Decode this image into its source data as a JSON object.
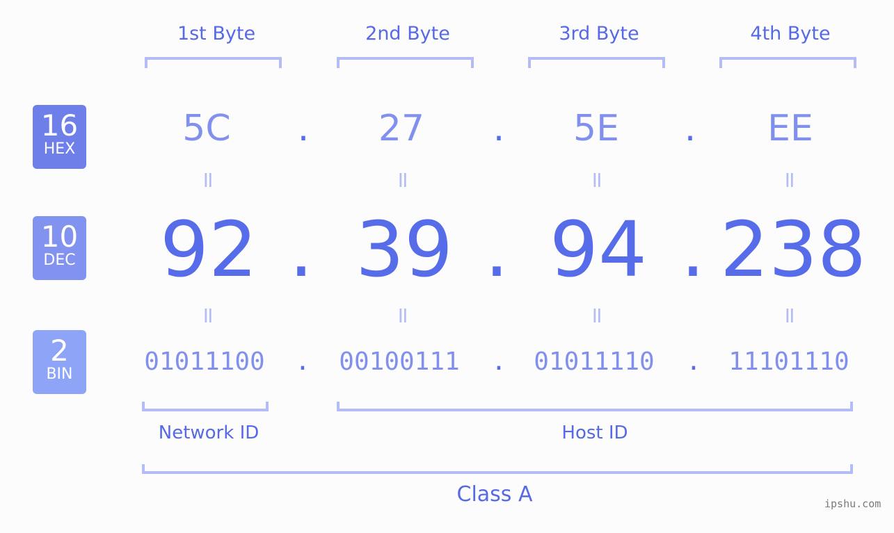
{
  "byte_headers": [
    "1st Byte",
    "2nd Byte",
    "3rd Byte",
    "4th Byte"
  ],
  "badges": {
    "hex": {
      "number": "16",
      "label": "HEX"
    },
    "dec": {
      "number": "10",
      "label": "DEC"
    },
    "bin": {
      "number": "2",
      "label": "BIN"
    }
  },
  "hex_octets": [
    "5C",
    "27",
    "5E",
    "EE"
  ],
  "dec_octets": [
    "92",
    "39",
    "94",
    "238"
  ],
  "bin_octets": [
    "01011100",
    "00100111",
    "01011110",
    "11101110"
  ],
  "separator": ".",
  "equals": "=",
  "network_id_label": "Network ID",
  "host_id_label": "Host ID",
  "class_label": "Class A",
  "watermark": "ipshu.com",
  "colors": {
    "accent": "#566ce8",
    "light_accent": "#8190ec",
    "bracket": "#b3bcf7",
    "hex_badge": "#6e7fe9",
    "dec_badge": "#8192ef",
    "bin_badge": "#8ea4f6"
  }
}
